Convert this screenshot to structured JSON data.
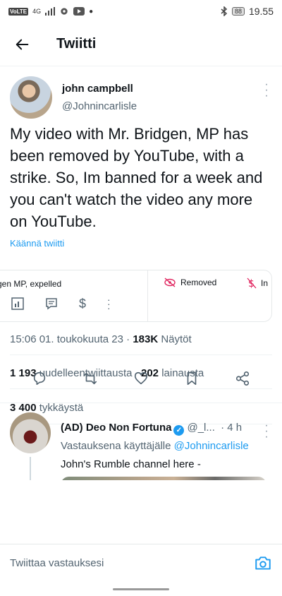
{
  "status_bar": {
    "network": "VoLTE",
    "signal": "4G",
    "battery": "88",
    "time": "19.55"
  },
  "header": {
    "title": "Twiitti"
  },
  "tweet": {
    "author_name": "john campbell",
    "author_handle": "@Johnincarlisle",
    "text": "My video with Mr. Bridgen, MP has been removed by YouTube, with a strike. So, Im banned for a week and you can't watch the video any more on YouTube.",
    "translate": "Käännä twiitti",
    "card": {
      "left_label": "gen MP, expelled",
      "chip_removed": "Removed",
      "chip_next": "In"
    },
    "timestamp": "15:06 01. toukokuuta 23",
    "views_count": "183K",
    "views_label": "Näytöt",
    "retweets_count": "1 193",
    "retweets_label": "uudelleentwiittausta",
    "quotes_count": "202",
    "quotes_label": "lainausta",
    "likes_count": "3 400",
    "likes_label": "tykkäystä"
  },
  "reply": {
    "name": "(AD) Deo Non Fortuna",
    "handle": "@_l...",
    "time": "· 4 h",
    "replying_prefix": "Vastauksena käyttäjälle",
    "replying_handle": "@Johnincarlisle",
    "text": "John's Rumble channel here -"
  },
  "compose": {
    "placeholder": "Twiittaa vastauksesi"
  },
  "colors": {
    "accent": "#1d9bf0",
    "text": "#0f1419",
    "muted": "#536471"
  }
}
